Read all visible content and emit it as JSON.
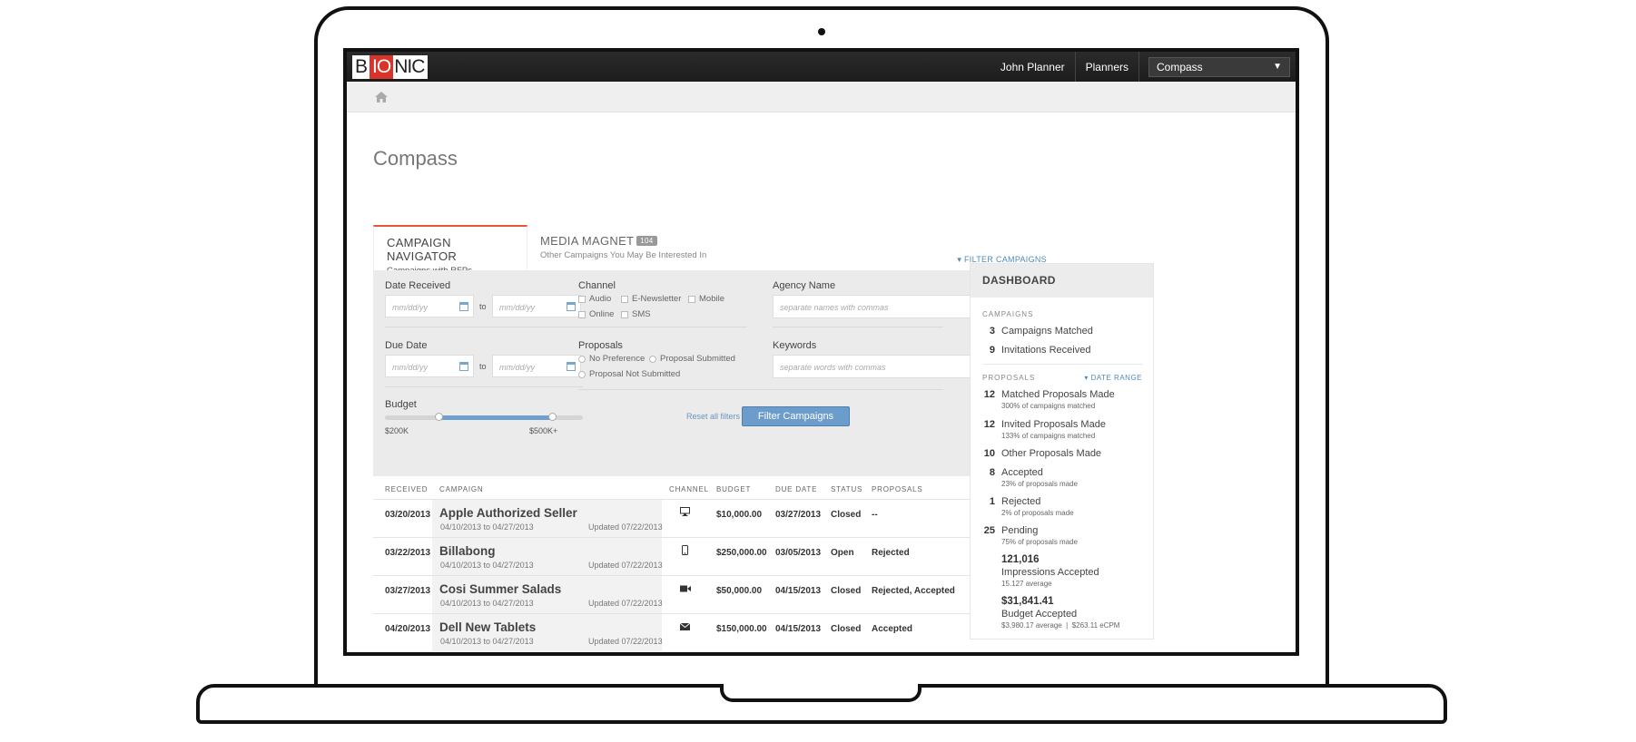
{
  "topbar": {
    "logo_b": "B",
    "logo_io": "IO",
    "logo_nic": "NIC",
    "user": "John Planner",
    "planners": "Planners",
    "selector": "Compass",
    "selector_arrow": "▼"
  },
  "page": {
    "title": "Compass",
    "home_icon": "home-icon"
  },
  "tabs": [
    {
      "title": "CAMPAIGN NAVIGATOR",
      "subtitle": "Campaigns with RFPs"
    },
    {
      "title": "MEDIA MAGNET",
      "badge": "104",
      "subtitle": "Other Campaigns You May Be Interested In"
    }
  ],
  "filter_toggle": "▾ FILTER CAMPAIGNS",
  "filters": {
    "date_received": "Date Received",
    "due_date": "Due Date",
    "date_placeholder": "mm/dd/yy",
    "to": "to",
    "budget": "Budget",
    "budget_min": "$200K",
    "budget_max": "$500K+",
    "channel": "Channel",
    "channel_options": [
      "Audio",
      "E-Newsletter",
      "Mobile",
      "Online",
      "SMS"
    ],
    "proposals": "Proposals",
    "proposal_options": [
      "No Preference",
      "Proposal Submitted",
      "Proposal Not Submitted"
    ],
    "agency_name": "Agency Name",
    "agency_placeholder": "separate names with commas",
    "keywords": "Keywords",
    "keywords_placeholder": "separate words with commas",
    "reset": "Reset all filters",
    "submit": "Filter Campaigns"
  },
  "table": {
    "headers": [
      "RECEIVED",
      "CAMPAIGN",
      "CHANNEL",
      "BUDGET",
      "DUE DATE",
      "STATUS",
      "PROPOSALS"
    ],
    "rows": [
      {
        "received": "03/20/2013",
        "campaign": "Apple Authorized Seller",
        "dates": "04/10/2013 to 04/27/2013",
        "updated": "Updated 07/22/2013",
        "channel_icon": "desktop-icon",
        "budget": "$10,000.00",
        "due": "03/27/2013",
        "status": "Closed",
        "proposals": "--"
      },
      {
        "received": "03/22/2013",
        "campaign": "Billabong",
        "dates": "04/10/2013 to 04/27/2013",
        "updated": "Updated 07/22/2013",
        "channel_icon": "mobile-icon",
        "budget": "$250,000.00",
        "due": "03/05/2013",
        "status": "Open",
        "proposals": "Rejected"
      },
      {
        "received": "03/27/2013",
        "campaign": "Cosi Summer Salads",
        "dates": "04/10/2013 to 04/27/2013",
        "updated": "Updated 07/22/2013",
        "channel_icon": "video-icon",
        "budget": "$50,000.00",
        "due": "04/15/2013",
        "status": "Closed",
        "proposals": "Rejected, Accepted"
      },
      {
        "received": "04/20/2013",
        "campaign": "Dell New Tablets",
        "dates": "04/10/2013 to 04/27/2013",
        "updated": "Updated 07/22/2013",
        "channel_icon": "envelope-icon",
        "budget": "$150,000.00",
        "due": "04/15/2013",
        "status": "Closed",
        "proposals": "Accepted"
      }
    ]
  },
  "dashboard": {
    "title": "DASHBOARD",
    "campaigns_label": "CAMPAIGNS",
    "campaigns": [
      {
        "num": "3",
        "label": "Campaigns Matched"
      },
      {
        "num": "9",
        "label": "Invitations Received"
      }
    ],
    "proposals_label": "PROPOSALS",
    "date_range": "▾ DATE RANGE",
    "proposals": [
      {
        "num": "12",
        "label": "Matched Proposals Made",
        "sub": "300% of campaigns matched"
      },
      {
        "num": "12",
        "label": "Invited Proposals Made",
        "sub": "133% of campaigns matched"
      },
      {
        "num": "10",
        "label": "Other Proposals Made",
        "sub": ""
      },
      {
        "num": "8",
        "label": "Accepted",
        "sub": "23% of proposals made"
      },
      {
        "num": "1",
        "label": "Rejected",
        "sub": "2% of proposals made"
      },
      {
        "num": "25",
        "label": "Pending",
        "sub": "75% of proposals made"
      }
    ],
    "impressions": {
      "value": "121,016",
      "label": "Impressions Accepted",
      "sub": "15.127 average"
    },
    "budget": {
      "value": "$31,841.41",
      "label": "Budget Accepted",
      "sub": "$3,980.17 average  |  $263.11 eCPM"
    }
  }
}
